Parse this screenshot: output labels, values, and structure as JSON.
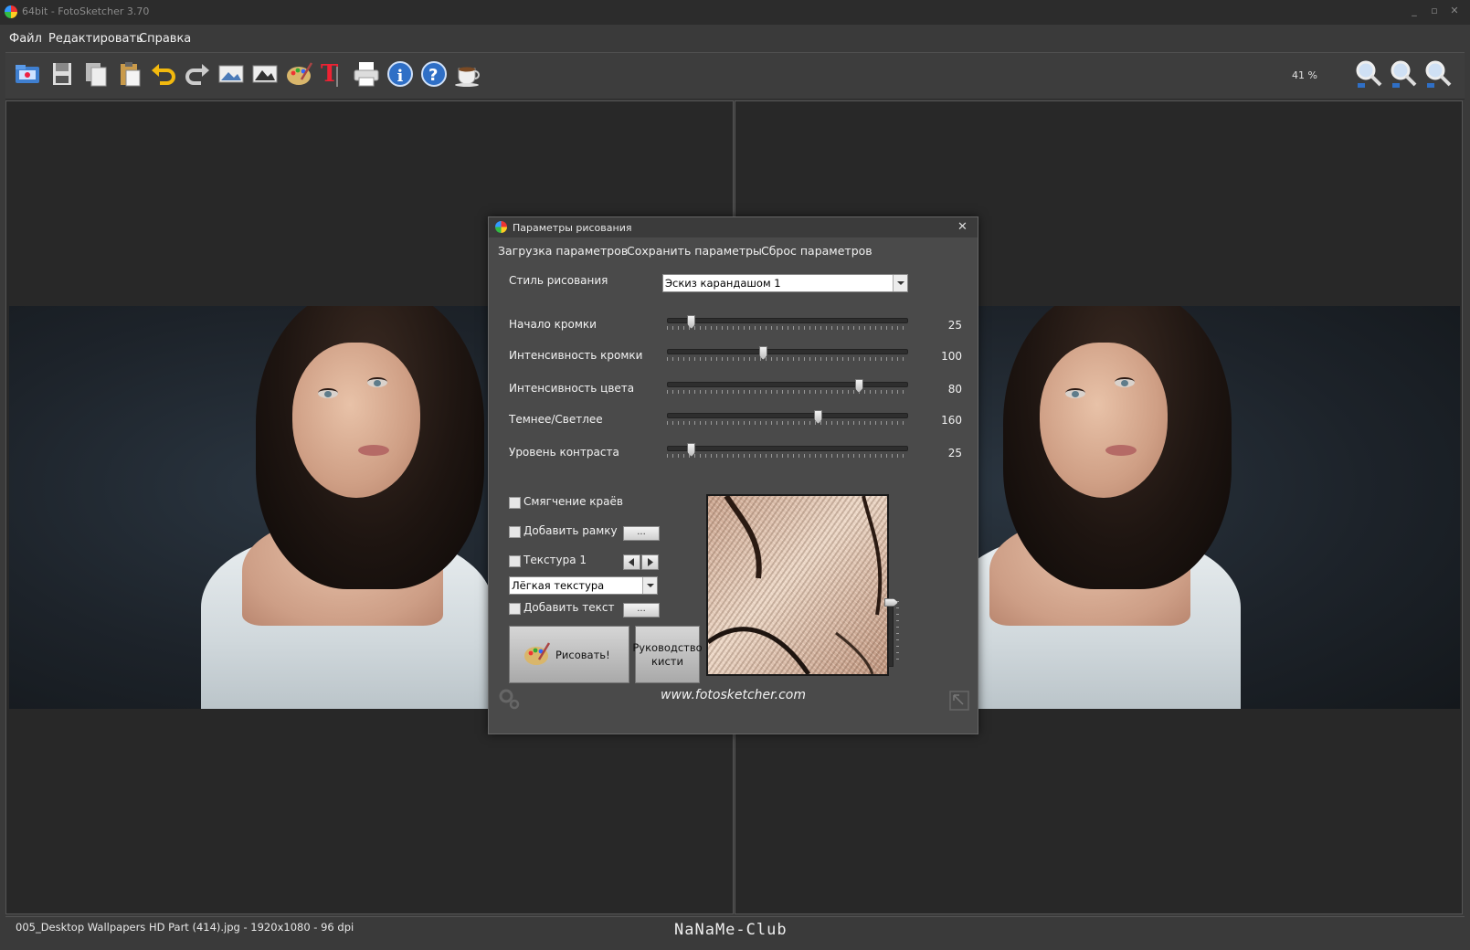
{
  "window": {
    "title": "64bit - FotoSketcher 3.70"
  },
  "menu": {
    "items": [
      "Файл",
      "Редактировать",
      "Справка"
    ]
  },
  "toolbar": {
    "icons": [
      "open-folder-icon",
      "save-icon",
      "copy-icon",
      "paste-icon",
      "undo-icon",
      "redo-icon",
      "original-image-icon",
      "result-image-icon",
      "palette-icon",
      "text-tool-icon",
      "print-icon",
      "info-icon",
      "help-icon",
      "coffee-icon"
    ],
    "zoom": "41 %",
    "zoom_icons": [
      "zoom-in-icon",
      "zoom-out-icon",
      "zoom-fit-icon"
    ]
  },
  "dialog": {
    "title": "Параметры рисования",
    "menu": [
      "Загрузка параметров",
      "Сохранить параметры",
      "Сброс параметров"
    ],
    "style_label": "Стиль рисования",
    "style_value": "Эскиз карандашом 1",
    "sliders": [
      {
        "label": "Начало кромки",
        "value": "25",
        "position": 0.1
      },
      {
        "label": "Интенсивность кромки",
        "value": "100",
        "position": 0.4
      },
      {
        "label": "Интенсивность цвета",
        "value": "80",
        "position": 0.8
      },
      {
        "label": "Темнее/Светлее",
        "value": "160",
        "position": 0.63
      },
      {
        "label": "Уровень контраста",
        "value": "25",
        "position": 0.1
      }
    ],
    "soften_edges": "Смягчение краёв",
    "add_frame": "Добавить рамку",
    "texture": "Текстура 1",
    "texture_value": "Лёгкая текстура",
    "add_text": "Добавить текст",
    "ellipsis": "...",
    "draw_button": "Рисовать!",
    "brush_guide": "Руководство кисти",
    "website": "www.fotosketcher.com"
  },
  "status": {
    "text": "005_Desktop Wallpapers  HD Part (414).jpg - 1920x1080 - 96 dpi",
    "watermark": "NaNaMe-Club"
  }
}
